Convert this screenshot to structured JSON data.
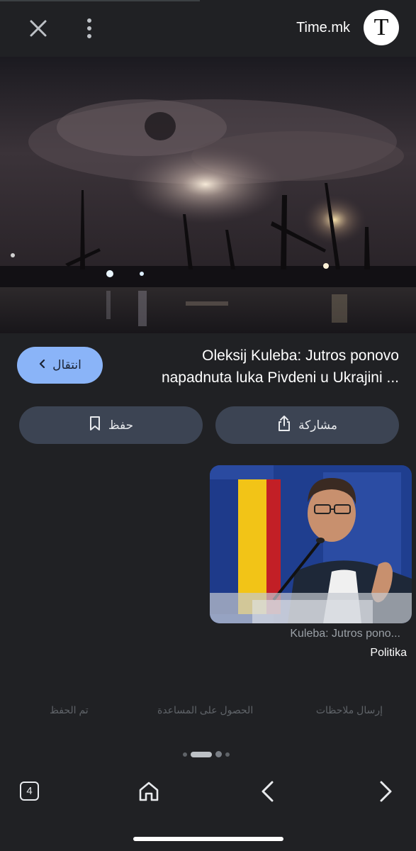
{
  "header": {
    "site_name": "Time.mk",
    "logo_letter": "T",
    "close_icon": "close-icon",
    "menu_icon": "more-vert-icon"
  },
  "hero": {
    "description_icon": "hero-image"
  },
  "article": {
    "title_line1": "Oleksij Kuleba: Jutros ponovo",
    "title_line2": "napadnuta luka Pivdeni u Ukrajini ...",
    "visit_label": "انتقال",
    "visit_icon": "chevron-left-icon"
  },
  "actions": {
    "save_label": "حفظ",
    "save_icon": "bookmark-icon",
    "share_label": "مشاركة",
    "share_icon": "share-icon"
  },
  "related": [
    {
      "title": "Kuleba: Jutros pono...",
      "source": "Politika"
    }
  ],
  "footer": {
    "feedback": "إرسال ملاحظات",
    "help": "الحصول على المساعدة",
    "saved": "تم الحفظ"
  },
  "bottom_nav": {
    "tab_count": "4",
    "home_icon": "home-icon",
    "back_icon": "chevron-left-icon",
    "forward_icon": "chevron-right-icon"
  },
  "colors": {
    "background": "#202124",
    "accent": "#8ab4f8",
    "button_bg": "#3c4453"
  }
}
